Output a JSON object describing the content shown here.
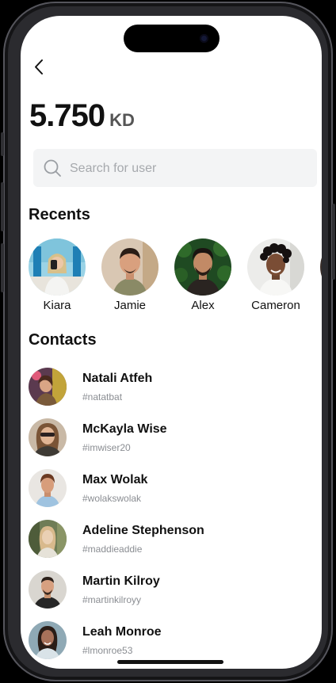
{
  "balance": {
    "amount": "5.750",
    "currency": "KD"
  },
  "search": {
    "placeholder": "Search for user"
  },
  "sections": {
    "recents": "Recents",
    "contacts": "Contacts"
  },
  "recents": [
    {
      "name": "Kiara"
    },
    {
      "name": "Jamie"
    },
    {
      "name": "Alex"
    },
    {
      "name": "Cameron"
    }
  ],
  "contacts": [
    {
      "name": "Natali Atfeh",
      "handle": "#natatbat"
    },
    {
      "name": "McKayla Wise",
      "handle": "#imwiser20"
    },
    {
      "name": "Max Wolak",
      "handle": "#wolakswolak"
    },
    {
      "name": "Adeline Stephenson",
      "handle": "#maddieaddie"
    },
    {
      "name": "Martin Kilroy",
      "handle": "#martinkilroyy"
    },
    {
      "name": "Leah Monroe",
      "handle": "#lmonroe53"
    }
  ],
  "icons": {
    "back": "chevron-left-icon",
    "search": "search-icon"
  }
}
